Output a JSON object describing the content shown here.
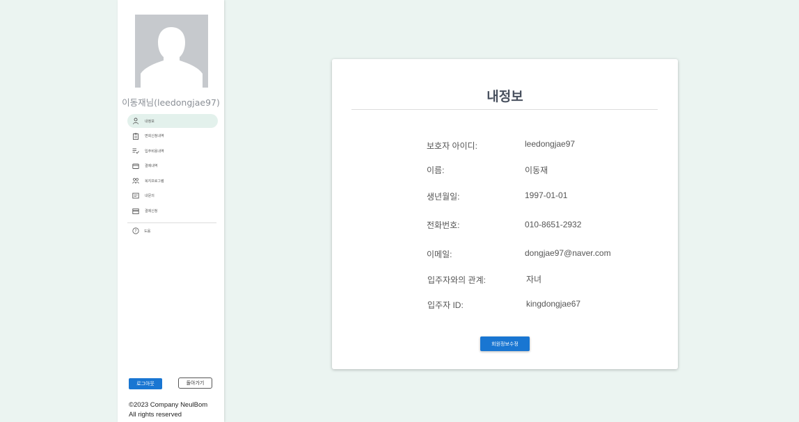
{
  "sidebar": {
    "user_name": "이동재님(leedongjae97)",
    "menu": [
      {
        "label": "내정보",
        "icon": "person-icon",
        "active": true
      },
      {
        "label": "면회신청내역",
        "icon": "clipboard-icon",
        "active": false
      },
      {
        "label": "입주비용내역",
        "icon": "checklist-icon",
        "active": false
      },
      {
        "label": "결제내역",
        "icon": "credit-card-icon",
        "active": false
      },
      {
        "label": "복지프로그램",
        "icon": "people-icon",
        "active": false
      },
      {
        "label": "내문의",
        "icon": "message-icon",
        "active": false
      },
      {
        "label": "결제신청",
        "icon": "payment-icon",
        "active": false
      }
    ],
    "help_label": "도움",
    "logout_label": "로그아웃",
    "back_label": "돌아가기",
    "copyright_line1": "©2023 Company NeulBom",
    "copyright_line2": "All rights reserved"
  },
  "profile": {
    "title": "내정보",
    "rows": [
      {
        "label": "보호자 아이디:",
        "value": "leedongjae97"
      },
      {
        "label": "이름:",
        "value": "이동재"
      },
      {
        "label": "생년월일:",
        "value": "1997-01-01"
      },
      {
        "label": "전화번호:",
        "value": "010-8651-2932"
      },
      {
        "label": "이메일:",
        "value": "dongjae97@naver.com"
      },
      {
        "label": "입주자와의 관계:",
        "value": "자녀"
      },
      {
        "label": "입주자 ID:",
        "value": "kingdongjae67"
      }
    ],
    "edit_button": "회원정보수정"
  },
  "colors": {
    "background": "#ebf4f1",
    "accent": "#1976d2",
    "active_menu": "#e3f1ec"
  }
}
